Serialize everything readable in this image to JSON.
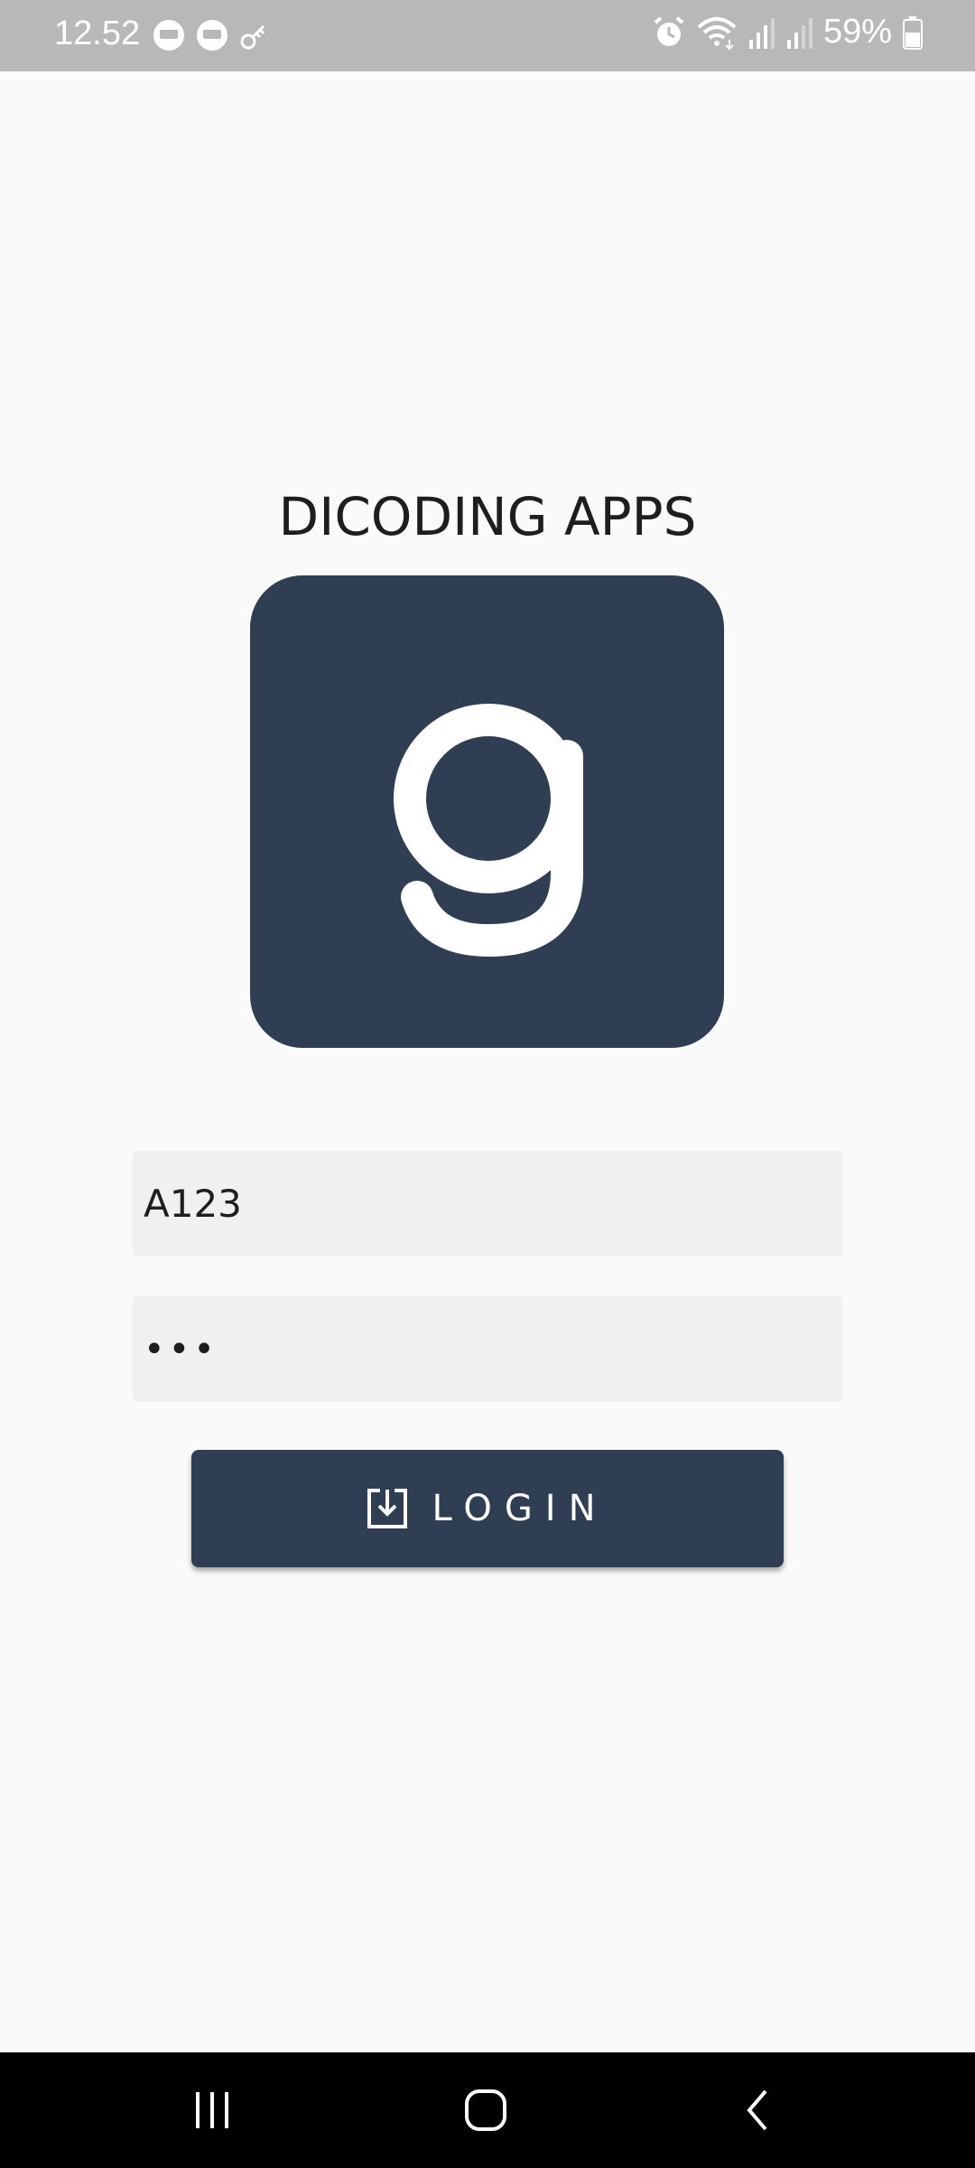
{
  "status_bar": {
    "time": "12.52",
    "battery": "59%",
    "left_icons": [
      "message-icon",
      "message-icon",
      "key-icon"
    ],
    "right_icons": [
      "alarm-icon",
      "wifi-icon",
      "signal-icon",
      "signal-icon",
      "battery-icon"
    ]
  },
  "app": {
    "title": "DICODING APPS"
  },
  "form": {
    "username_value": "A123",
    "password_value": "•••",
    "login_label": "LOGIN",
    "login_icon": "login-icon"
  },
  "colors": {
    "primary": "#2f3e52",
    "background": "#fafafa",
    "field_bg": "#f0f0f0",
    "status_bar": "#b8b8b8"
  },
  "nav_bar": {
    "buttons": [
      "recent-apps-icon",
      "home-icon",
      "back-icon"
    ]
  }
}
